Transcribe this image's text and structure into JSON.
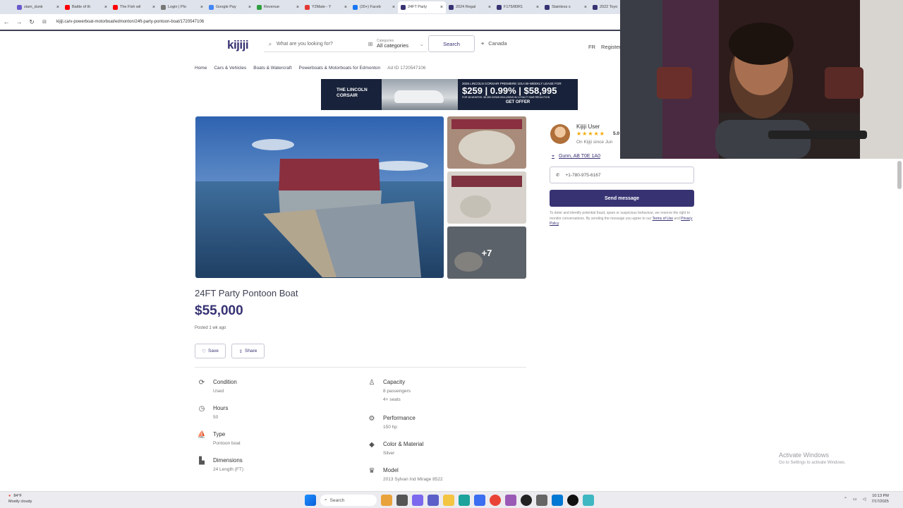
{
  "browser": {
    "tabs": [
      {
        "label": "slam_dunk",
        "color": "#6a5acd"
      },
      {
        "label": "Battle of th",
        "color": "#ff0000"
      },
      {
        "label": "The Fish wil",
        "color": "#ff0000"
      },
      {
        "label": "Login | Plo",
        "color": "#777777"
      },
      {
        "label": "Google Pay",
        "color": "#4285f4"
      },
      {
        "label": "Revenue",
        "color": "#2e9e3e"
      },
      {
        "label": "Y2Mate - Y",
        "color": "#e53935"
      },
      {
        "label": "(20+) Faceb",
        "color": "#1877f2"
      },
      {
        "label": "24FT Party",
        "color": "#373373",
        "active": true
      },
      {
        "label": "2024 Regal",
        "color": "#373373"
      },
      {
        "label": "F175/80R1",
        "color": "#373373"
      },
      {
        "label": "Stainless s",
        "color": "#373373"
      },
      {
        "label": "2022 Toyo",
        "color": "#373373"
      }
    ],
    "url": "kijiji.ca/v-powerboat-motorboat/edmonton/24ft-party-pontoon-boat/1720547106"
  },
  "header": {
    "logo": "kijiji",
    "search_placeholder": "What are you looking for?",
    "categories_label": "Categories",
    "categories_value": "All categories",
    "search_button": "Search",
    "location": "Canada",
    "lang": "FR",
    "register": "Register"
  },
  "breadcrumbs": [
    "Home",
    "Cars & Vehicles",
    "Boats & Watercraft",
    "Powerboats & Motorboats for Edmonton",
    "Ad ID 1720547106"
  ],
  "ad_banner": {
    "brand": "THE LINCOLN CORSAIR",
    "headline": "2025 LINCOLN CORSAIR PREMIERE 101A BI-WEEKLY LEASE FOR",
    "offer": "$259 | 0.99% | $58,995",
    "fine_print": "FOR 48 MONTHS. $3,450 DOWN INCLUDING $1 LOYALTY BAR REDUCTION",
    "cta": "GET OFFER"
  },
  "listing": {
    "title": "24FT Party Pontoon Boat",
    "price": "$55,000",
    "posted": "Posted 1 wk ago",
    "save": "Save",
    "share": "Share",
    "more_photos": "+7",
    "attributes_left": [
      {
        "icon": "condition-icon",
        "glyph": "⟳",
        "label": "Condition",
        "value": "Used"
      },
      {
        "icon": "hours-icon",
        "glyph": "◷",
        "label": "Hours",
        "value": "50"
      },
      {
        "icon": "type-icon",
        "glyph": "⛵",
        "label": "Type",
        "value": "Pontoon boat"
      },
      {
        "icon": "dimensions-icon",
        "glyph": "▙",
        "label": "Dimensions",
        "value": "24 Length (FT)"
      }
    ],
    "attributes_right": [
      {
        "icon": "capacity-icon",
        "glyph": "♙",
        "label": "Capacity",
        "value": "8 passengers",
        "value2": "4+ seats"
      },
      {
        "icon": "performance-icon",
        "glyph": "⚙",
        "label": "Performance",
        "value": "150 hp"
      },
      {
        "icon": "color-material-icon",
        "glyph": "◆",
        "label": "Color & Material",
        "value": "Silver"
      },
      {
        "icon": "model-icon",
        "glyph": "♛",
        "label": "Model",
        "value": "2013 Sylvan Ind Mirage 8522"
      }
    ]
  },
  "seller": {
    "name": "Kijiji User",
    "stars": "★★★★★",
    "rating": "5.0",
    "since": "On Kijiji since Jun",
    "location": "Gunn, AB T0E 1A0",
    "phone": "+1-780-975-6167",
    "send": "Send message",
    "disclaimer_main": "To deter and identify potential fraud, spam or suspicious behaviour, we reserve the right to monitor conversations. By sending the message you agree to our",
    "terms": "Terms of Use",
    "and": "and",
    "privacy": "Privacy Policy"
  },
  "windows_watermark": {
    "title": "Activate Windows",
    "subtitle": "Go to Settings to activate Windows."
  },
  "taskbar": {
    "weather_temp": "84°F",
    "weather_desc": "Mostly cloudy",
    "search": "Search",
    "time": "10:13 PM",
    "date": "7/17/2025"
  }
}
